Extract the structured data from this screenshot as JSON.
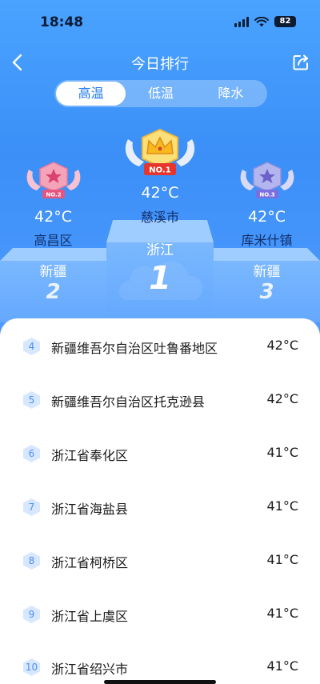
{
  "status": {
    "time": "18:48",
    "battery": "82"
  },
  "nav": {
    "title": "今日排行"
  },
  "tabs": [
    {
      "label": "高温",
      "active": true
    },
    {
      "label": "低温",
      "active": false
    },
    {
      "label": "降水",
      "active": false
    }
  ],
  "podium": {
    "first": {
      "badge": "NO.1",
      "temp": "42°C",
      "city": "慈溪市",
      "province": "浙江",
      "rank": "1"
    },
    "second": {
      "badge": "NO.2",
      "temp": "42°C",
      "city": "高昌区",
      "province": "新疆",
      "rank": "2"
    },
    "third": {
      "badge": "NO.3",
      "temp": "42°C",
      "city": "库米什镇",
      "province": "新疆",
      "rank": "3"
    }
  },
  "list": [
    {
      "rank": "4",
      "name": "新疆维吾尔自治区吐鲁番地区",
      "temp": "42°C"
    },
    {
      "rank": "5",
      "name": "新疆维吾尔自治区托克逊县",
      "temp": "42°C"
    },
    {
      "rank": "6",
      "name": "浙江省奉化区",
      "temp": "41°C"
    },
    {
      "rank": "7",
      "name": "浙江省海盐县",
      "temp": "41°C"
    },
    {
      "rank": "8",
      "name": "浙江省柯桥区",
      "temp": "41°C"
    },
    {
      "rank": "9",
      "name": "浙江省上虞区",
      "temp": "41°C"
    },
    {
      "rank": "10",
      "name": "浙江省绍兴市",
      "temp": "41°C"
    }
  ],
  "colors": {
    "accent": "#1f7af0",
    "hero": "#3b8ff7",
    "city_text": "#12306b",
    "gold": "#f7b91e"
  }
}
